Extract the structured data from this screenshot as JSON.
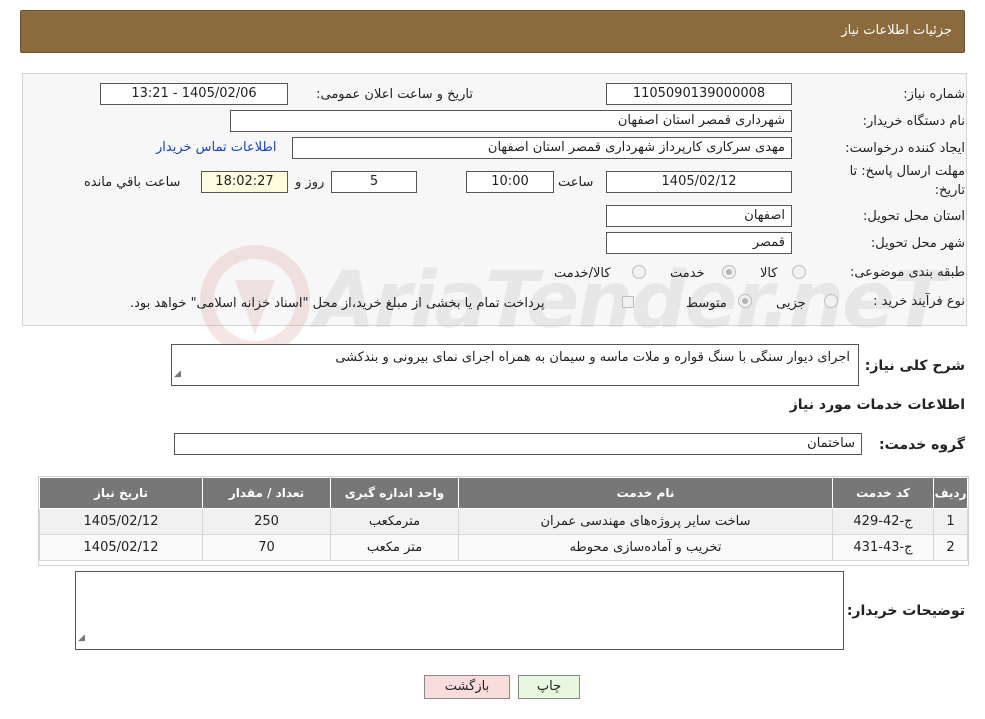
{
  "header": {
    "title": "جزئیات اطلاعات نیاز"
  },
  "form": {
    "need_number_label": "شماره نیاز:",
    "need_number": "1105090139000008",
    "announce_label": "تاریخ و ساعت اعلان عمومی:",
    "announce_value": "1405/02/06 - 13:21",
    "buyer_org_label": "نام دستگاه خریدار:",
    "buyer_org": "شهرداری قمصر استان اصفهان",
    "creator_label": "ایجاد کننده درخواست:",
    "creator": "مهدی سرکاری کارپرداز شهرداری قمصر استان اصفهان",
    "contact_link": "اطلاعات تماس خریدار",
    "deadline_label_1": "مهلت ارسال پاسخ: تا",
    "deadline_label_2": "تاریخ:",
    "deadline_date": "1405/02/12",
    "time_label": "ساعت",
    "deadline_time": "10:00",
    "days_value": "5",
    "days_label": "روز و",
    "remaining_time": "18:02:27",
    "remaining_label": "ساعت باقي مانده",
    "province_label": "استان محل تحویل:",
    "province": "اصفهان",
    "city_label": "شهر محل تحویل:",
    "city": "قمصر",
    "category_label": "طبقه بندی موضوعی:",
    "category_options": [
      "کالا",
      "خدمت",
      "کالا/خدمت"
    ],
    "category_selected": "خدمت",
    "purchase_label": "نوع فرآیند خرید :",
    "purchase_options": [
      "جزیی",
      "متوسط"
    ],
    "purchase_selected": "متوسط",
    "payment_note": "پرداخت تمام یا بخشی از مبلغ خرید،از محل \"اسناد خزانه اسلامی\" خواهد بود."
  },
  "description": {
    "label": "شرح کلی نیاز:",
    "text": "اجرای دیوار سنگی با سنگ قواره و ملات ماسه و سیمان به همراه اجرای نمای بیرونی و بندکشی"
  },
  "services": {
    "title": "اطلاعات خدمات مورد نیاز",
    "group_label": "گروه خدمت:",
    "group_value": "ساختمان",
    "columns": [
      "ردیف",
      "کد خدمت",
      "نام خدمت",
      "واحد اندازه گیری",
      "تعداد / مقدار",
      "تاریخ نیاز"
    ],
    "rows": [
      [
        "1",
        "ج-42-429",
        "ساخت سایر پروژه‌های مهندسی عمران",
        "مترمکعب",
        "250",
        "1405/02/12"
      ],
      [
        "2",
        "ج-43-431",
        "تخریب و آماده‌سازی محوطه",
        "متر مکعب",
        "70",
        "1405/02/12"
      ]
    ]
  },
  "buyer_notes": {
    "label": "توضیحات خریدار:",
    "text": ""
  },
  "buttons": {
    "print": "چاپ",
    "back": "بازگشت"
  },
  "watermark": "AriaTender.neT"
}
